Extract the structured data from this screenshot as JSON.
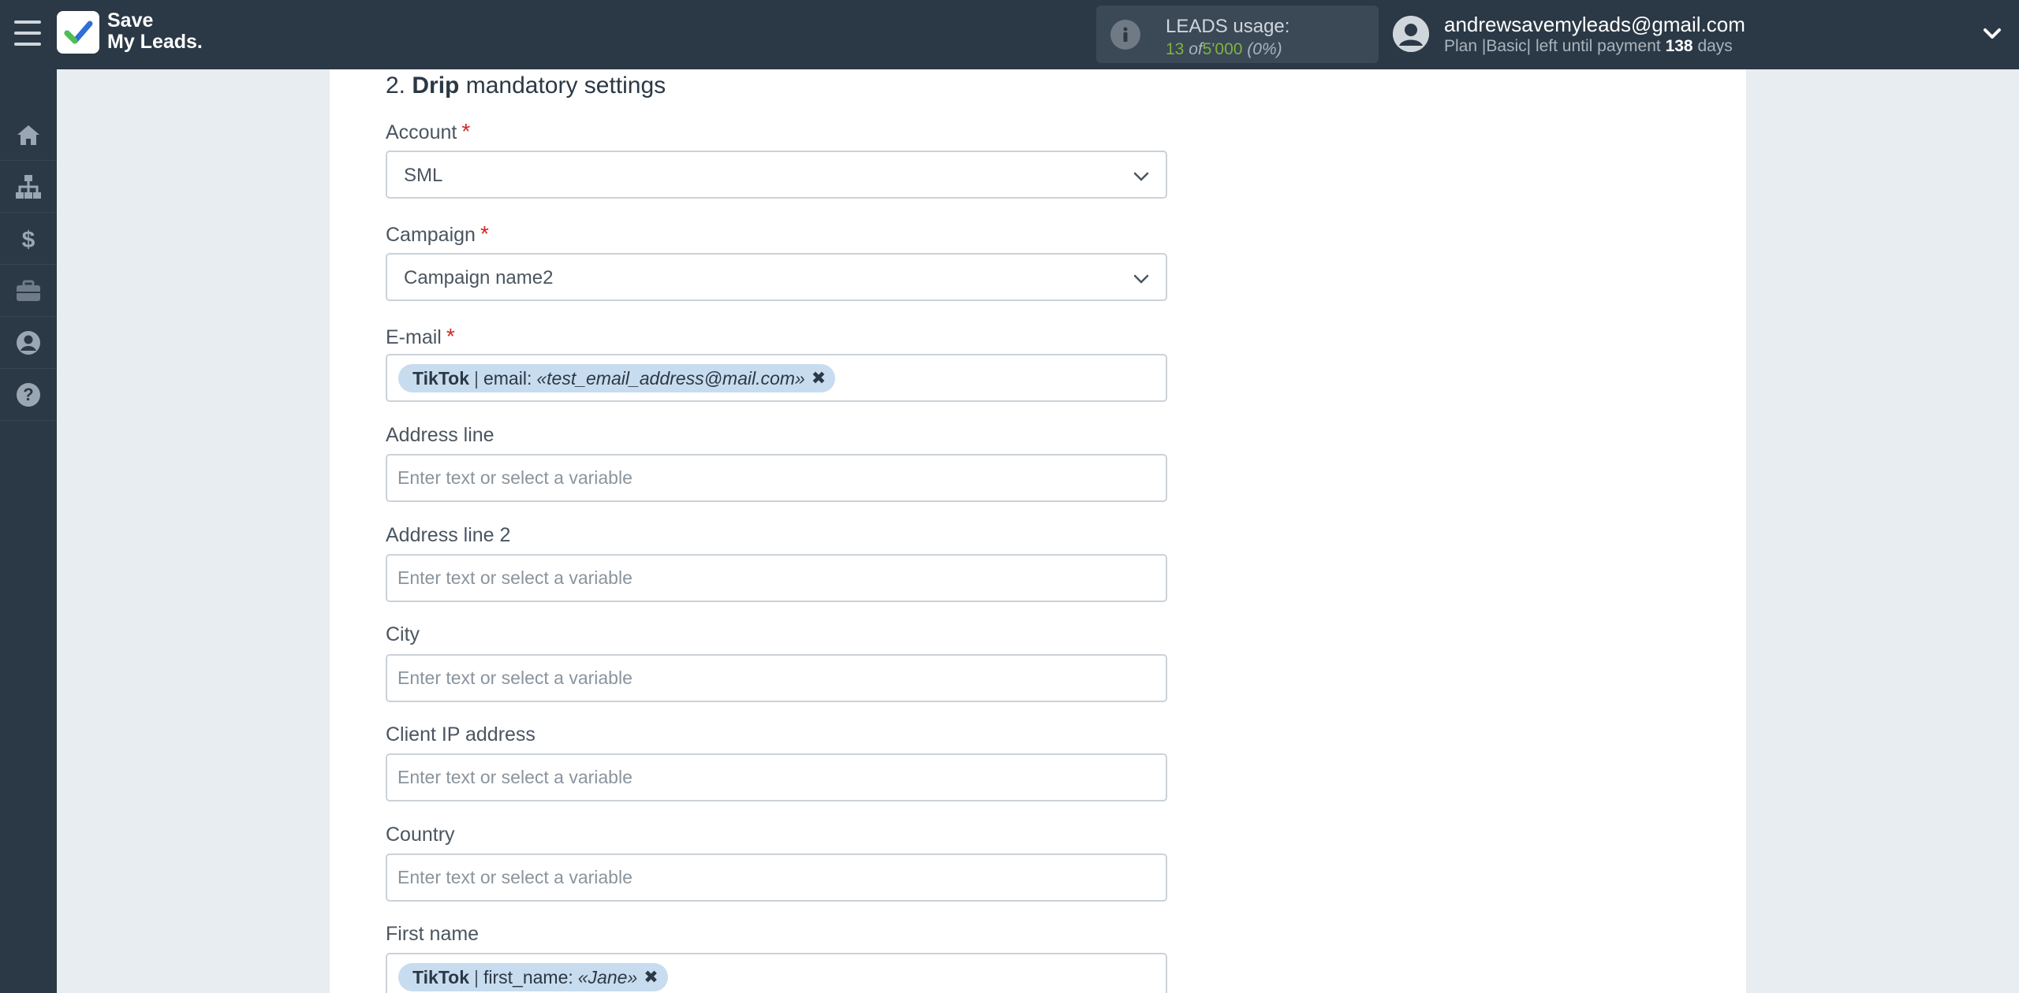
{
  "header": {
    "logo_line1": "Save",
    "logo_line2": "My Leads.",
    "usage_title": "LEADS usage:",
    "usage_used": "13",
    "usage_of": "of",
    "usage_total": "5'000",
    "usage_pct": "(0%)",
    "user_email": "andrewsavemyleads@gmail.com",
    "plan_prefix": "Plan |Basic| left until payment",
    "plan_days": "138",
    "plan_suffix": "days"
  },
  "sidebar": {
    "items": [
      {
        "icon": "home-icon"
      },
      {
        "icon": "sitemap-icon"
      },
      {
        "icon": "dollar-icon"
      },
      {
        "icon": "briefcase-icon"
      },
      {
        "icon": "user-circle-icon"
      },
      {
        "icon": "help-icon"
      }
    ]
  },
  "section": {
    "number": "2.",
    "service": "Drip",
    "rest": "mandatory settings"
  },
  "fields": {
    "account": {
      "label": "Account",
      "value": "SML"
    },
    "campaign": {
      "label": "Campaign",
      "value": "Campaign name2"
    },
    "email": {
      "label": "E-mail",
      "tag_source": "TikTok",
      "tag_sep": "|",
      "tag_field": "email:",
      "tag_value": "«test_email_address@mail.com»",
      "tag_remove": "✖"
    },
    "address_line": {
      "label": "Address line",
      "placeholder": "Enter text or select a variable"
    },
    "address_line_2": {
      "label": "Address line 2",
      "placeholder": "Enter text or select a variable"
    },
    "city": {
      "label": "City",
      "placeholder": "Enter text or select a variable"
    },
    "client_ip": {
      "label": "Client IP address",
      "placeholder": "Enter text or select a variable"
    },
    "country": {
      "label": "Country",
      "placeholder": "Enter text or select a variable"
    },
    "first_name": {
      "label": "First name",
      "tag_source": "TikTok",
      "tag_sep": "|",
      "tag_field": "first_name:",
      "tag_value": "«Jane»",
      "tag_remove": "✖"
    }
  },
  "colors": {
    "header_bg": "#2b3845",
    "sidebar_bg": "#2b3845",
    "accent_green": "#7fb33f",
    "required_red": "#d02626",
    "tag_bg": "#c8dcef"
  }
}
